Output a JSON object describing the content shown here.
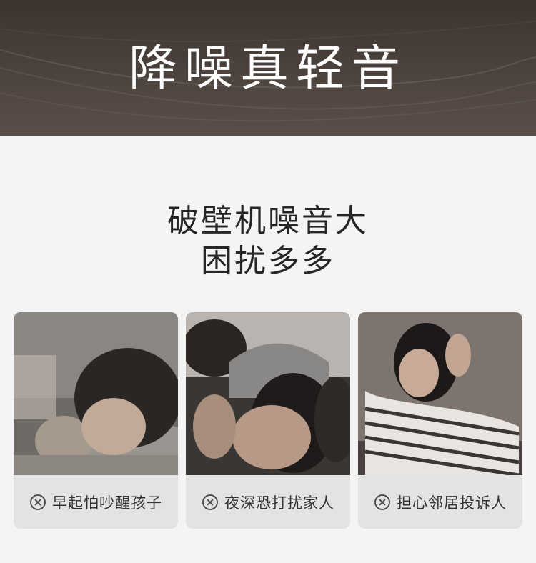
{
  "banner": {
    "title": "降噪真轻音"
  },
  "headline": {
    "line1": "破壁机噪音大",
    "line2": "困扰多多"
  },
  "cards": [
    {
      "caption": "早起怕吵醒孩子",
      "icon": "close-circle-icon",
      "photo": "sleeping-child-photo"
    },
    {
      "caption": "夜深恐打扰家人",
      "icon": "close-circle-icon",
      "photo": "man-covering-ears-photo"
    },
    {
      "caption": "担心邻居投诉人",
      "icon": "close-circle-icon",
      "photo": "stressed-woman-photo"
    }
  ],
  "colors": {
    "banner": "#43392f",
    "background": "#f4f4f4",
    "caption_bg": "#e3e3e3",
    "text": "#262626"
  }
}
